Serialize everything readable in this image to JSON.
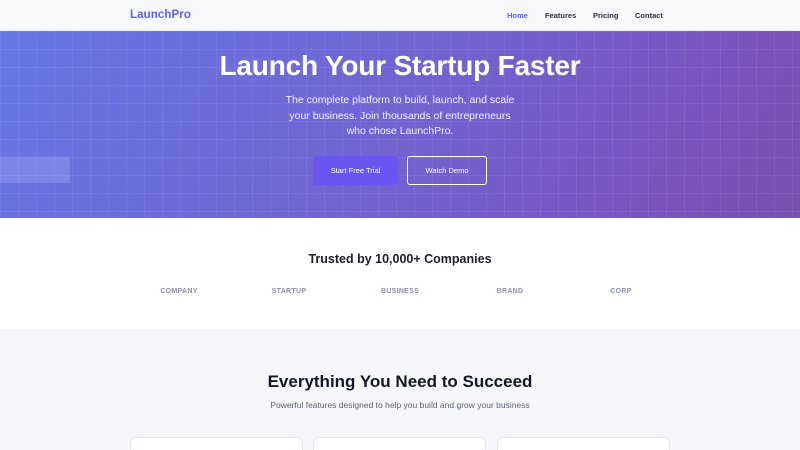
{
  "nav": {
    "brand": "LaunchPro",
    "links": [
      {
        "label": "Home",
        "active": true
      },
      {
        "label": "Features",
        "active": false
      },
      {
        "label": "Pricing",
        "active": false
      },
      {
        "label": "Contact",
        "active": false
      }
    ]
  },
  "hero": {
    "title": "Launch Your Startup Faster",
    "subtitle": "The complete platform to build, launch, and scale your business. Join thousands of entrepreneurs who chose LaunchPro.",
    "primary_cta": "Start Free Trial",
    "secondary_cta": "Watch Demo"
  },
  "trusted": {
    "title": "Trusted by 10,000+ Companies",
    "logos": [
      "COMPANY",
      "STARTUP",
      "BUSINESS",
      "BRAND",
      "CORP"
    ]
  },
  "features": {
    "title": "Everything You Need to Succeed",
    "subtitle": "Powerful features designed to help you build and grow your business"
  },
  "colors": {
    "accent": "#5b5ef0",
    "hero_gradient_start": "#6677e6",
    "hero_gradient_end": "#7a4fb0",
    "primary_button": "#6a55f2"
  }
}
